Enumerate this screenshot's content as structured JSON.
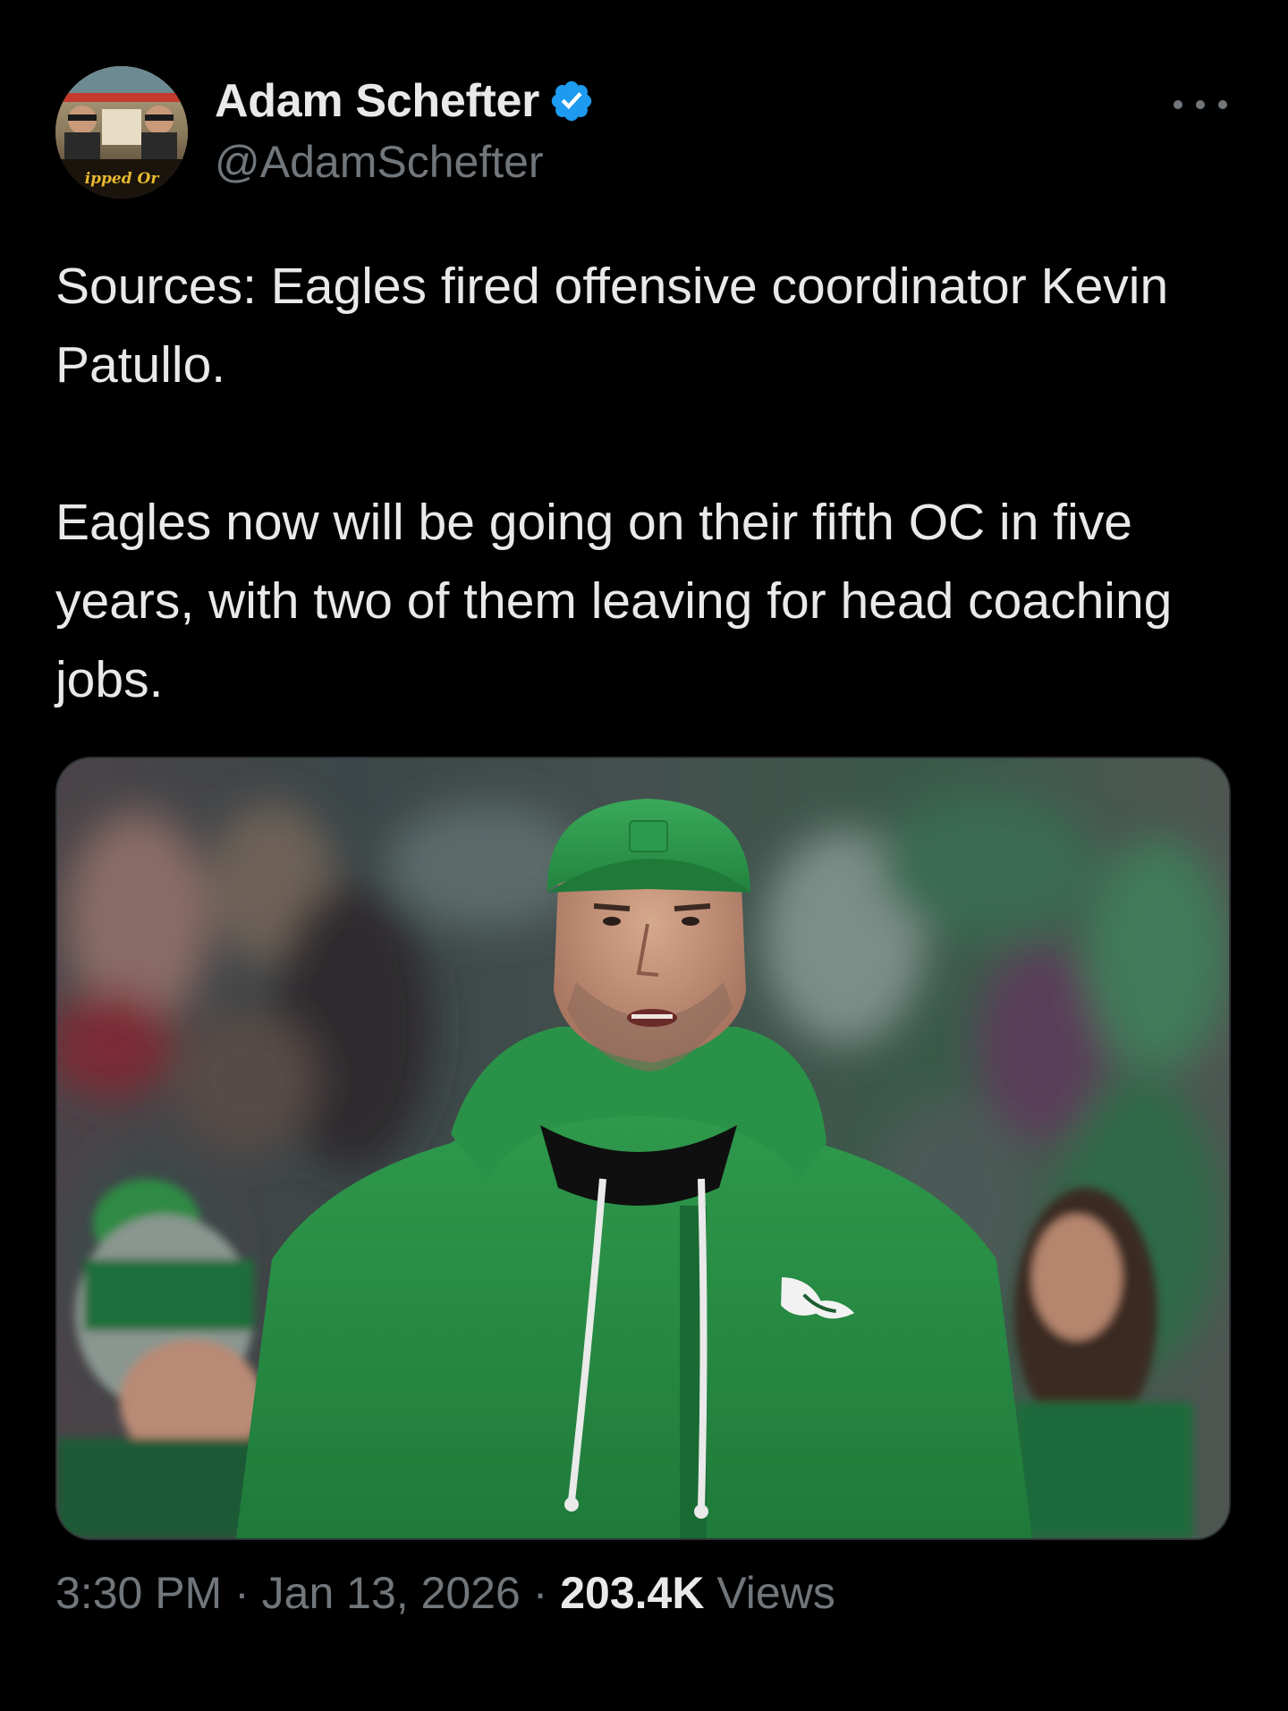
{
  "tweet": {
    "author": {
      "display_name": "Adam Schefter",
      "handle": "@AdamSchefter",
      "verified": true,
      "avatar_caption": "ipped Or"
    },
    "text": "Sources: Eagles fired offensive coordinator Kevin Patullo.\n\nEagles now will be going on their fifth OC in five years, with two of them leaving for head coaching jobs.",
    "meta": {
      "time": "3:30 PM",
      "separator": " · ",
      "date": "Jan 13, 2026",
      "views_count": "203.4K",
      "views_label": " Views"
    }
  },
  "icons": {
    "verified": "verified-badge-icon",
    "more": "more-options-icon"
  },
  "colors": {
    "background": "#000000",
    "primary_text": "#e7e9ea",
    "secondary_text": "#71767b",
    "verified_blue": "#1d9bf0",
    "eagles_kelly_green": "#2e8b44"
  }
}
